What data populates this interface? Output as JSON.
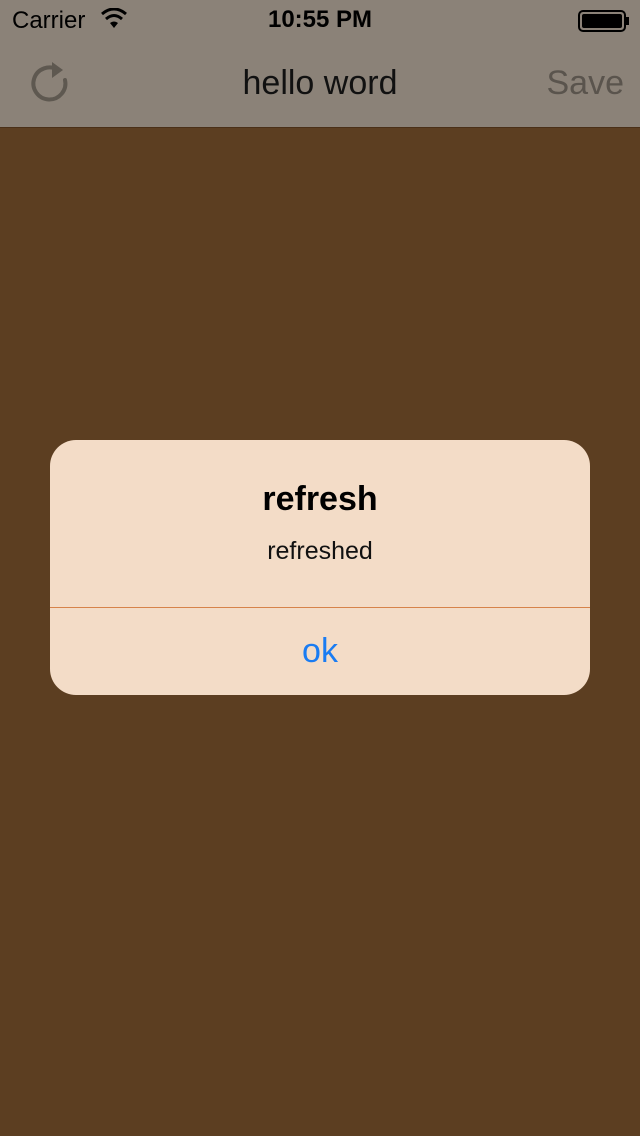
{
  "status_bar": {
    "carrier": "Carrier",
    "time": "10:55 PM",
    "wifi_icon": "wifi-icon",
    "battery_icon": "battery-icon"
  },
  "nav_bar": {
    "title": "hello word",
    "left_icon": "refresh-icon",
    "right_label": "Save"
  },
  "alert": {
    "title": "refresh",
    "message": "refreshed",
    "button_label": "ok"
  },
  "colors": {
    "background": "#5c3e21",
    "bar": "#8b8278",
    "alert_background": "#f3dcc7",
    "alert_button": "#1a7cf2",
    "divider": "#d6834a"
  }
}
